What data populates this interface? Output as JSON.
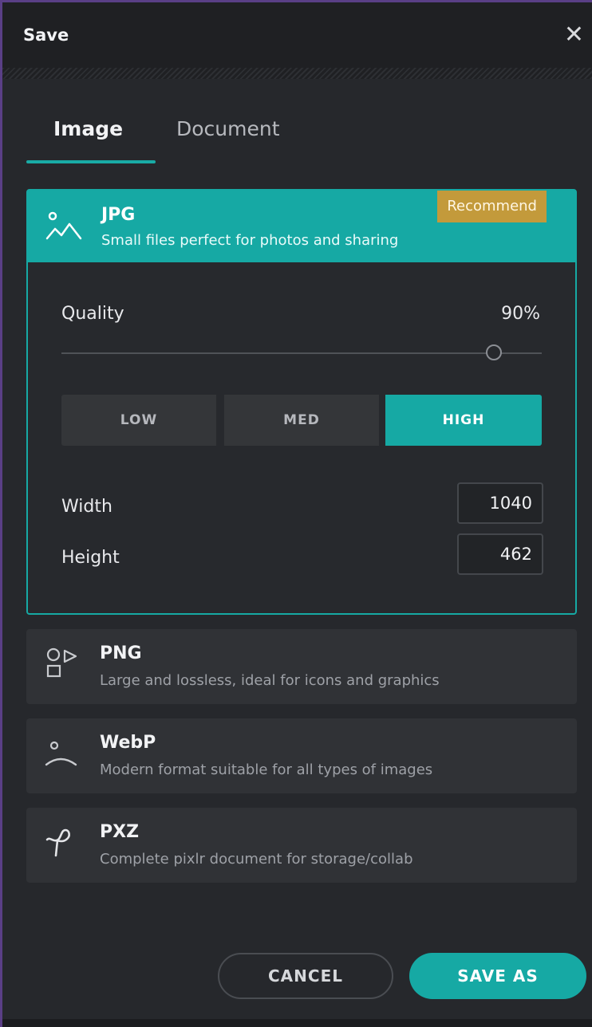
{
  "dialog": {
    "title": "Save"
  },
  "tabs": [
    {
      "label": "Image",
      "active": true
    },
    {
      "label": "Document",
      "active": false
    }
  ],
  "formats": {
    "jpg": {
      "name": "JPG",
      "description": "Small files perfect for photos and sharing",
      "badge": "Recommend",
      "selected": true,
      "icon": "landscape-icon"
    },
    "png": {
      "name": "PNG",
      "description": "Large and lossless, ideal for icons and graphics",
      "icon": "shapes-icon"
    },
    "webp": {
      "name": "WebP",
      "description": "Modern format suitable for all types of images",
      "icon": "horizon-icon"
    },
    "pxz": {
      "name": "PXZ",
      "description": "Complete pixlr document for storage/collab",
      "icon": "pixlr-document-icon"
    }
  },
  "quality": {
    "label": "Quality",
    "value_text": "90%",
    "value": 90,
    "presets": [
      {
        "label": "LOW",
        "active": false
      },
      {
        "label": "MED",
        "active": false
      },
      {
        "label": "HIGH",
        "active": true
      }
    ]
  },
  "dimensions": {
    "width_label": "Width",
    "width_value": "1040",
    "height_label": "Height",
    "height_value": "462"
  },
  "actions": {
    "cancel_label": "CANCEL",
    "save_as_label": "SAVE AS"
  },
  "colors": {
    "accent": "#16a9a4",
    "badge": "#c39a3b",
    "background": "#26282c"
  }
}
